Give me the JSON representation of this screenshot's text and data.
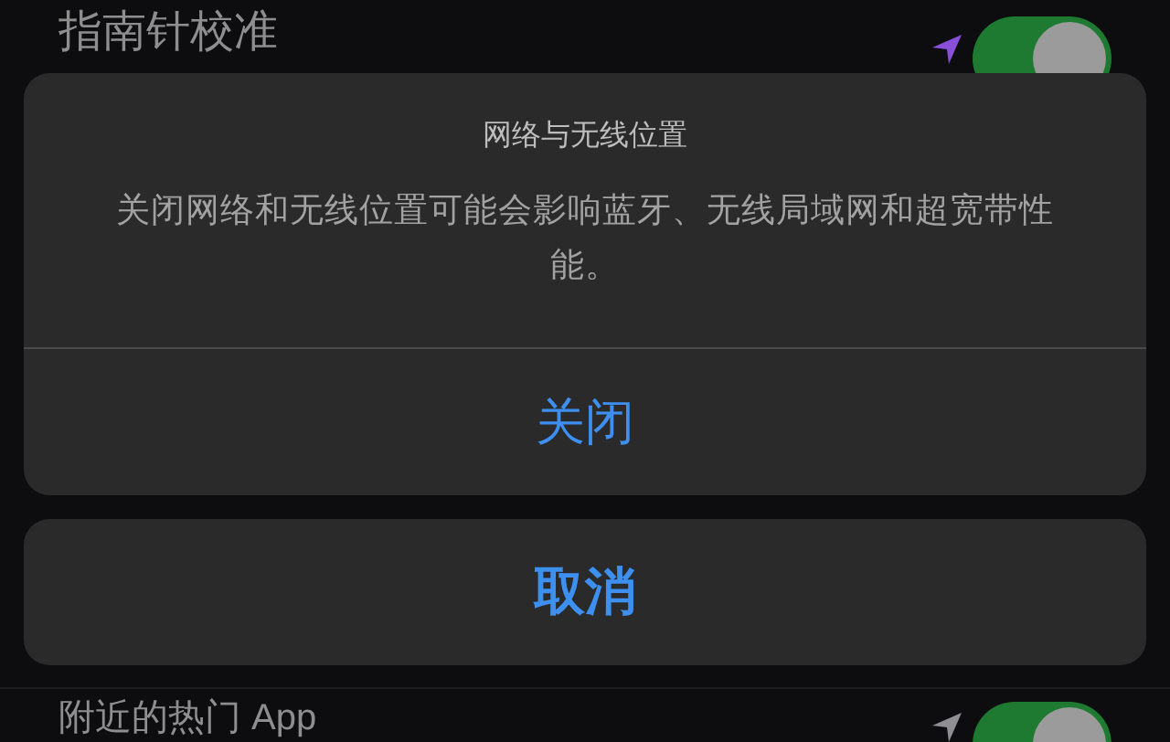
{
  "settings_rows": [
    {
      "label": "指南针校准",
      "on": true,
      "color": "#8a4fd8"
    },
    {
      "label": "附近的热门 App",
      "on": true,
      "color": "#8e8e93"
    }
  ],
  "action_sheet": {
    "title": "网络与无线位置",
    "message": "关闭网络和无线位置可能会影响蓝牙、无线局域网和超宽带性能。",
    "action": "关闭",
    "cancel": "取消"
  }
}
